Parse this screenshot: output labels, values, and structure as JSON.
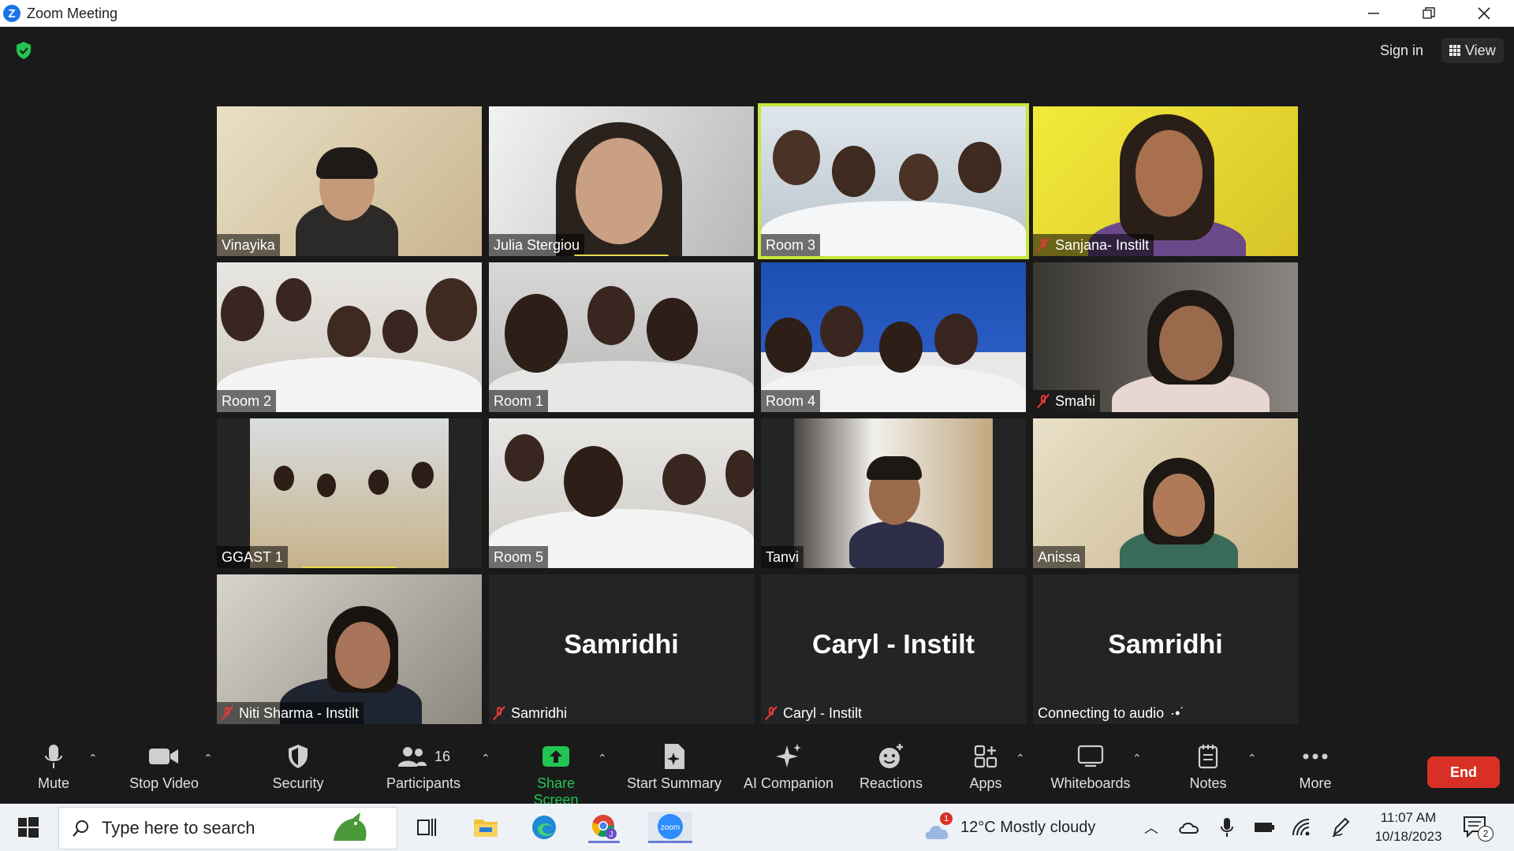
{
  "window": {
    "title": "Zoom Meeting",
    "logo_letter": "Z"
  },
  "header": {
    "sign_in": "Sign in",
    "view": "View"
  },
  "tiles": [
    {
      "name": "Vinayika",
      "muted": false
    },
    {
      "name": "Julia Stergiou",
      "muted": false,
      "speaking": true
    },
    {
      "name": "Room 3",
      "muted": false,
      "active": true
    },
    {
      "name": "Sanjana- Instilt",
      "muted": true
    },
    {
      "name": "Room 2",
      "muted": false
    },
    {
      "name": "Room 1",
      "muted": false
    },
    {
      "name": "Room 4",
      "muted": false
    },
    {
      "name": "Smahi",
      "muted": true
    },
    {
      "name": "GGAST 1",
      "muted": false,
      "speaking": true
    },
    {
      "name": "Room 5",
      "muted": false
    },
    {
      "name": "Tanvi",
      "muted": false
    },
    {
      "name": "Anissa",
      "muted": false
    },
    {
      "name": "Niti Sharma - Instilt",
      "muted": true
    },
    {
      "name": "Samridhi",
      "muted": true,
      "big_name": "Samridhi"
    },
    {
      "name": "Caryl - Instilt",
      "muted": true,
      "big_name": "Caryl - Instilt"
    },
    {
      "name": "Connecting to audio",
      "muted": false,
      "big_name": "Samridhi",
      "connecting": true
    }
  ],
  "toolbar": {
    "mute": "Mute",
    "stop_video": "Stop Video",
    "security": "Security",
    "participants": "Participants",
    "participants_count": "16",
    "share_screen": "Share Screen",
    "start_summary": "Start Summary",
    "ai_companion": "AI Companion",
    "reactions": "Reactions",
    "apps": "Apps",
    "whiteboards": "Whiteboards",
    "notes": "Notes",
    "more": "More",
    "end": "End"
  },
  "taskbar": {
    "search_placeholder": "Type here to search",
    "weather_badge": "1",
    "weather": "12°C  Mostly cloudy",
    "time": "11:07 AM",
    "date": "10/18/2023",
    "notification_count": "2",
    "zoom_label": "zoom",
    "chrome_badge": "J"
  },
  "colors": {
    "active_border": "#c8e63c",
    "share_green": "#23c552",
    "end_red": "#d93025",
    "muted_red": "#e23b3b"
  }
}
